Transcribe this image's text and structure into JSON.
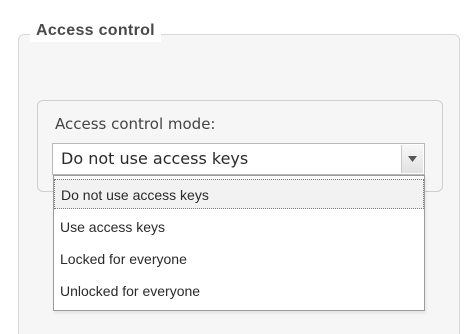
{
  "access_control": {
    "legend": "Access control",
    "mode_label": "Access control mode:",
    "mode_select": {
      "selected_value": "Do not use access keys",
      "options": [
        "Do not use access keys",
        "Use access keys",
        "Locked for everyone",
        "Unlocked for everyone"
      ]
    }
  },
  "icons": {
    "dropdown_arrow": "chevron-down-icon"
  },
  "colors": {
    "panel_background": "#f6f6f6",
    "text": "#2a2a2a",
    "border": "#b9b9b9"
  }
}
